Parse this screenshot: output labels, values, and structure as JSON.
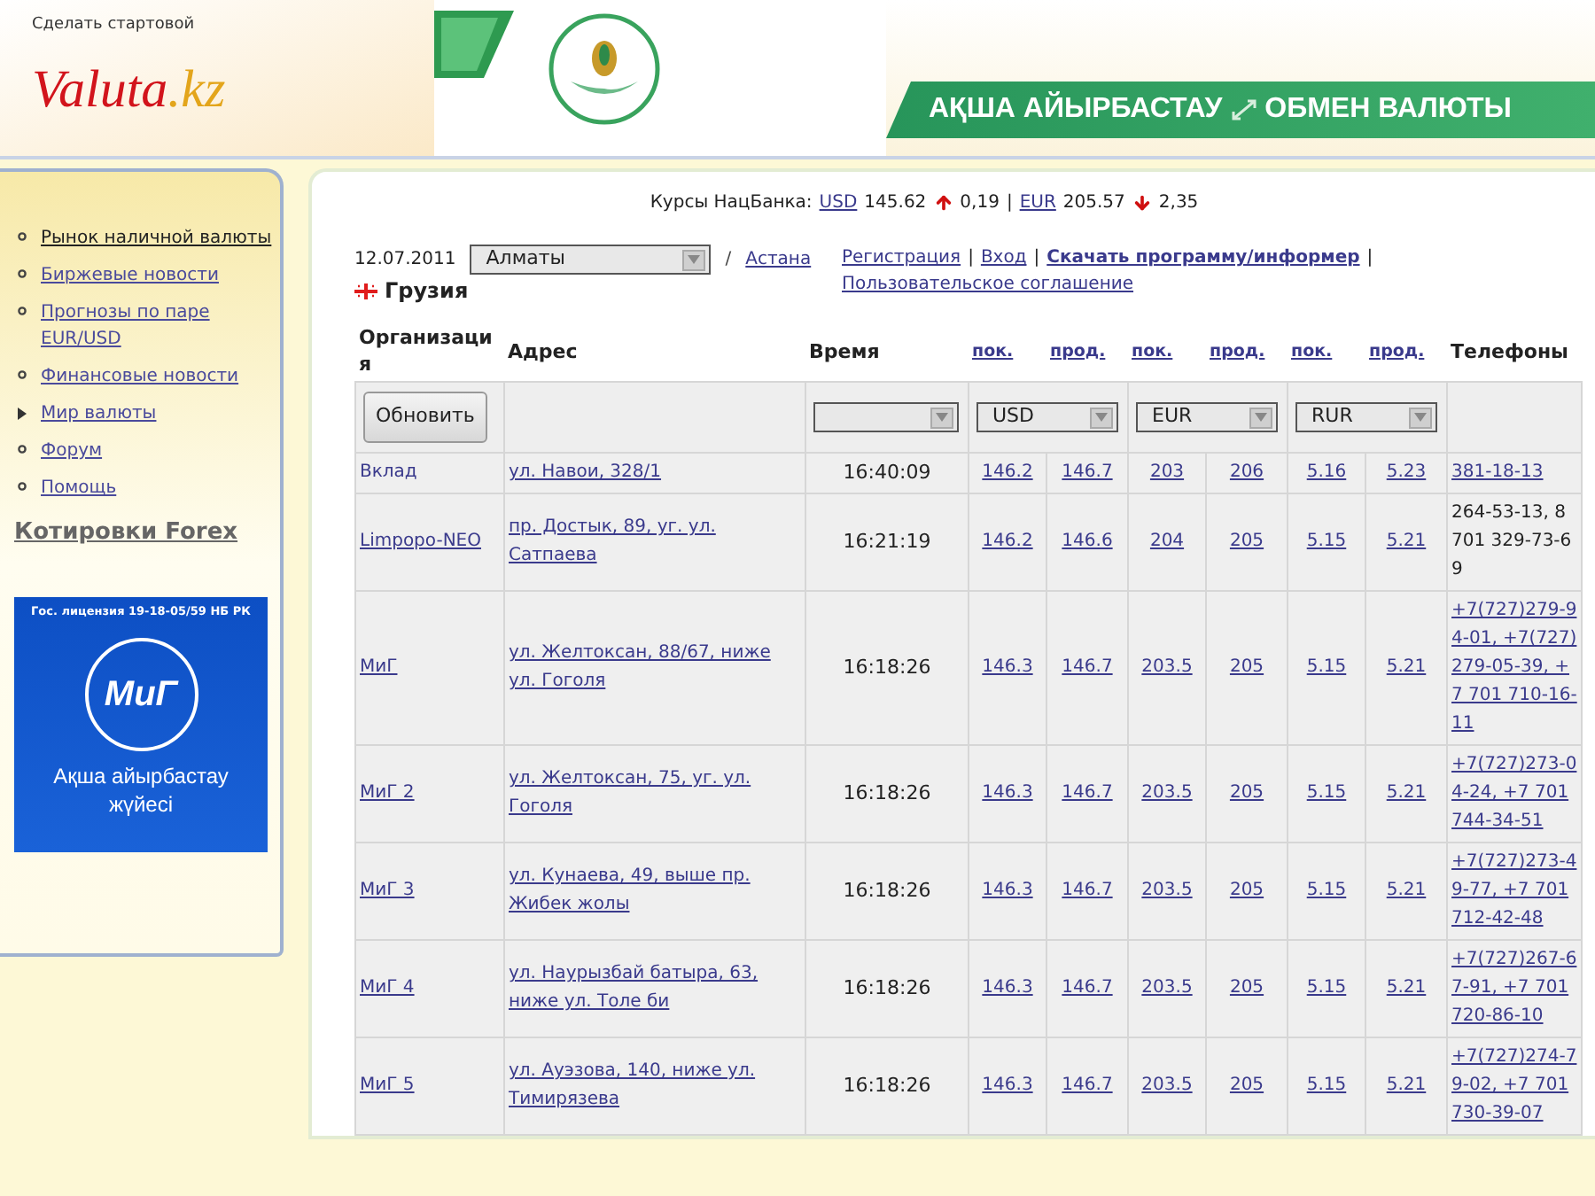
{
  "header": {
    "make_home": "Сделать стартовой",
    "logo_main": "Valuta",
    "logo_suffix": ".kz",
    "banner_left": "АҚША АЙЫРБАСТАУ",
    "banner_right": "ОБМЕН ВАЛЮТЫ"
  },
  "sidebar": {
    "items": [
      {
        "label": "Рынок наличной валюты",
        "kind": "bullet",
        "selected": true
      },
      {
        "label": "Биржевые новости",
        "kind": "bullet",
        "selected": false
      },
      {
        "label": "Прогнозы по паре EUR/USD",
        "kind": "bullet",
        "selected": false
      },
      {
        "label": "Финансовые новости",
        "kind": "bullet",
        "selected": false
      },
      {
        "label": "Мир валюты",
        "kind": "arrow",
        "selected": false
      },
      {
        "label": "Форум",
        "kind": "bullet",
        "selected": false
      },
      {
        "label": "Помощь",
        "kind": "bullet",
        "selected": false
      }
    ],
    "forex_link": "Котировки Forex",
    "ad": {
      "license": "Гос. лицензия 19-18-05/59 НБ РК",
      "brand": "МиГ",
      "tagline": "Ақша айырбастау жүйесі"
    }
  },
  "rates_bar": {
    "label": "Курсы НацБанка:",
    "usd_link": "USD",
    "usd_value": "145.62",
    "usd_change": "0,19",
    "usd_rising": true,
    "eur_link": "EUR",
    "eur_value": "205.57",
    "eur_change": "2,35",
    "eur_rising": false,
    "separator": "|"
  },
  "toolbar": {
    "date": "12.07.2011",
    "city": "Алматы",
    "city_separator": "/",
    "other_city": "Астана",
    "links": [
      {
        "label": "Регистрация",
        "separator": "|"
      },
      {
        "label": "Вход",
        "separator": "|"
      },
      {
        "label": "Скачать программу/информер",
        "separator": "|"
      },
      {
        "label": "Пользовательское соглашение"
      }
    ],
    "country": "Грузия"
  },
  "table": {
    "columns": [
      "Организация",
      "Адрес",
      "Время",
      "пок.",
      "прод.",
      "пок.",
      "прод.",
      "пок.",
      "прод.",
      "Телефоны"
    ],
    "refresh_button": "Обновить",
    "currency_selects": [
      "USD",
      "EUR",
      "RUR"
    ],
    "rows": [
      {
        "org": "Вклад",
        "org_link": false,
        "address": "ул. Навои, 328/1",
        "time": "16:40:09",
        "rates": [
          "146.2",
          "146.7",
          "203",
          "206",
          "5.16",
          "5.23"
        ],
        "phone": "381-18-13",
        "phone_link": true
      },
      {
        "org": "Limpopo-NEO",
        "org_link": true,
        "address": "пр. Достык, 89, уг. ул. Сатпаева",
        "time": "16:21:19",
        "rates": [
          "146.2",
          "146.6",
          "204",
          "205",
          "5.15",
          "5.21"
        ],
        "phone": "264-53-13, 8 701 329-73-69",
        "phone_link": false
      },
      {
        "org": "МиГ",
        "org_link": true,
        "address": "ул. Желтоксан, 88/67, ниже ул. Гоголя",
        "time": "16:18:26",
        "rates": [
          "146.3",
          "146.7",
          "203.5",
          "205",
          "5.15",
          "5.21"
        ],
        "phone": "+7(727)279-94-01, +7(727)279-05-39, +7 701 710-16-11",
        "phone_link": true
      },
      {
        "org": "МиГ 2",
        "org_link": true,
        "address": "ул. Желтоксан, 75, уг. ул. Гоголя",
        "time": "16:18:26",
        "rates": [
          "146.3",
          "146.7",
          "203.5",
          "205",
          "5.15",
          "5.21"
        ],
        "phone": "+7(727)273-04-24, +7 701 744-34-51",
        "phone_link": true
      },
      {
        "org": "МиГ 3",
        "org_link": true,
        "address": "ул. Кунаева, 49, выше пр. Жибек жолы",
        "time": "16:18:26",
        "rates": [
          "146.3",
          "146.7",
          "203.5",
          "205",
          "5.15",
          "5.21"
        ],
        "phone": "+7(727)273-49-77, +7 701 712-42-48",
        "phone_link": true
      },
      {
        "org": "МиГ 4",
        "org_link": true,
        "address": "ул. Наурызбай батыра, 63, ниже ул. Толе би",
        "time": "16:18:26",
        "rates": [
          "146.3",
          "146.7",
          "203.5",
          "205",
          "5.15",
          "5.21"
        ],
        "phone": "+7(727)267-67-91, +7 701 720-86-10",
        "phone_link": true
      },
      {
        "org": "МиГ 5",
        "org_link": true,
        "address": "ул. Ауэзова, 140, ниже ул. Тимирязева",
        "time": "16:18:26",
        "rates": [
          "146.3",
          "146.7",
          "203.5",
          "205",
          "5.15",
          "5.21"
        ],
        "phone": "+7(727)274-79-02, +7 701 730-39-07",
        "phone_link": true
      }
    ]
  }
}
